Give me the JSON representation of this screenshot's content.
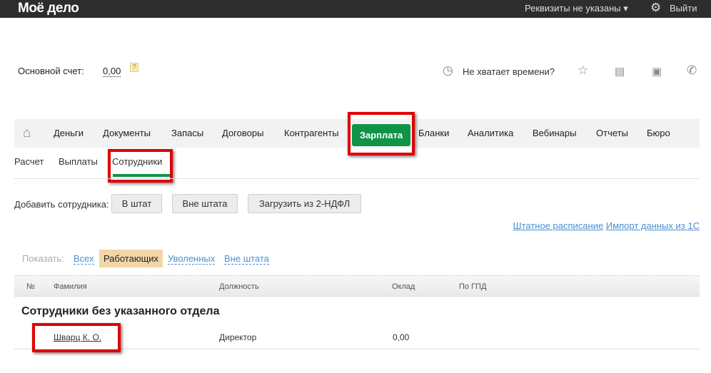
{
  "topbar": {
    "logo": "Моё дело",
    "requisites": "Реквизиты не указаны ▾",
    "logout": "Выйти"
  },
  "account": {
    "label": "Основной счет:",
    "value": "0,00",
    "help": "?"
  },
  "header_tools": {
    "time_text": "Не хватает времени?"
  },
  "nav": {
    "items": [
      "Деньги",
      "Документы",
      "Запасы",
      "Договоры",
      "Контрагенты",
      "Зарплата",
      "Бланки",
      "Аналитика",
      "Вебинары",
      "Отчеты",
      "Бюро"
    ],
    "active": "Зарплата"
  },
  "subnav": {
    "items": [
      "Расчет",
      "Выплаты",
      "Сотрудники"
    ],
    "active": "Сотрудники"
  },
  "add": {
    "label": "Добавить сотрудника:",
    "buttons": [
      "В штат",
      "Вне штата",
      "Загрузить из 2-НДФЛ"
    ]
  },
  "links": [
    "Штатное расписание",
    "Импорт данных из 1С"
  ],
  "filter": {
    "label": "Показать:",
    "options": [
      "Всех",
      "Работающих",
      "Уволенных",
      "Вне штата"
    ],
    "active": "Работающих"
  },
  "table": {
    "headers": [
      "№",
      "Фамилия",
      "Должность",
      "Оклад",
      "По ГПД"
    ],
    "group": "Сотрудники без указанного отдела",
    "rows": [
      {
        "name": "Шварц К. О.",
        "position": "Директор",
        "salary": "0,00"
      }
    ]
  },
  "colors": {
    "accent": "#0f9447",
    "highlight": "#e00000"
  }
}
